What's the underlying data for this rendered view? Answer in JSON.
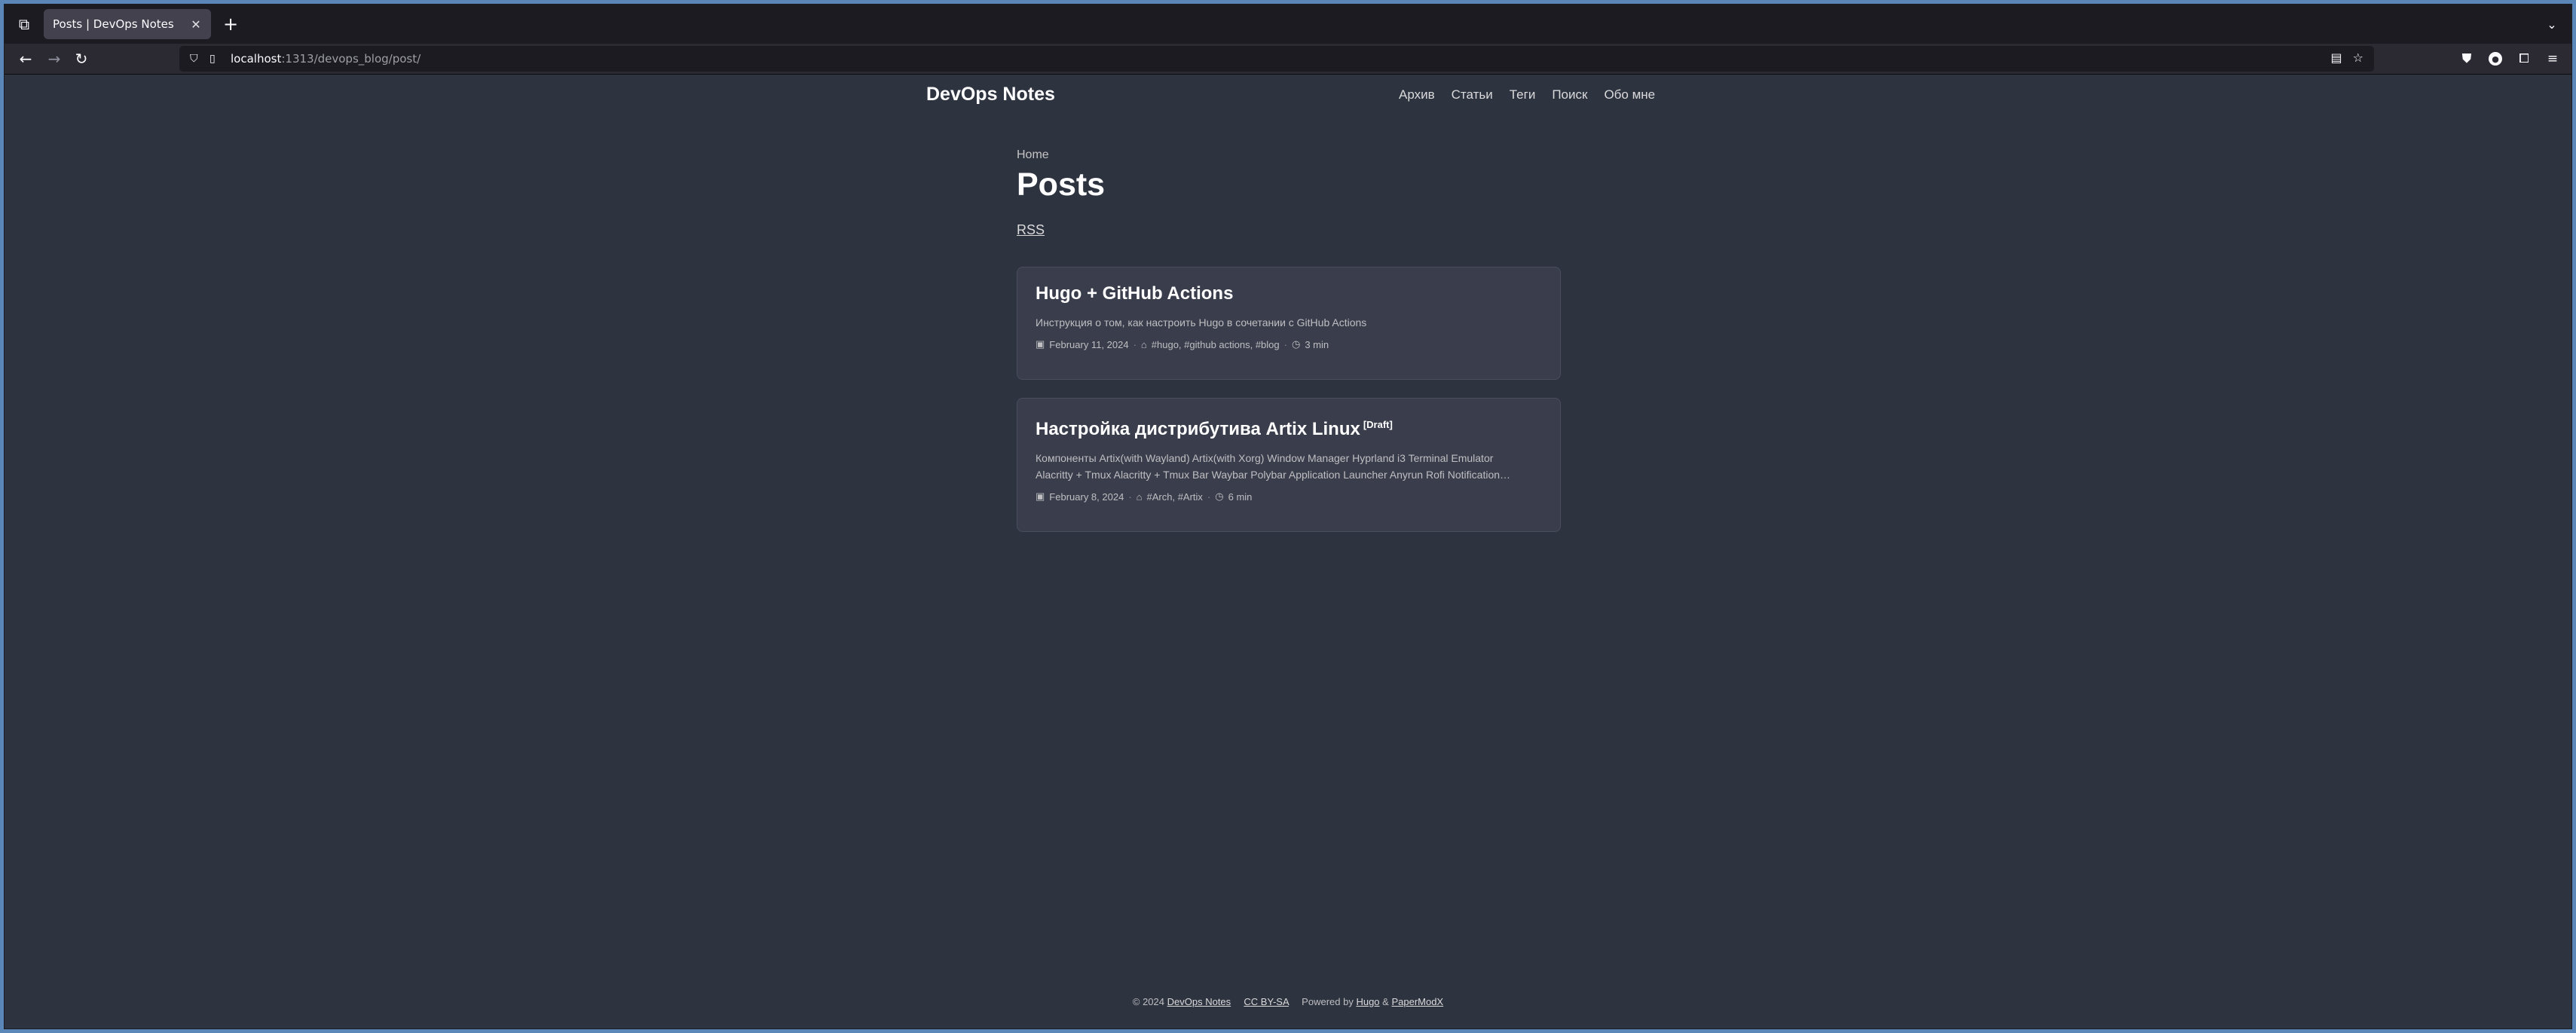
{
  "browser": {
    "tab_title": "Posts | DevOps Notes",
    "url_host": "localhost",
    "url_path": ":1313/devops_blog/post/"
  },
  "site": {
    "logo": "DevOps Notes",
    "menu": [
      "Архив",
      "Статьи",
      "Теги",
      "Поиск",
      "Обо мне"
    ]
  },
  "page": {
    "breadcrumb": "Home",
    "title": "Posts",
    "rss": "RSS"
  },
  "posts": [
    {
      "title": "Hugo + GitHub Actions",
      "draft": "",
      "summary": "Инструкция о том, как настроить Hugo в сочетании с GitHub Actions",
      "date": "February 11, 2024",
      "tags": "#hugo, #github actions, #blog",
      "reading_time": "3 min"
    },
    {
      "title": "Настройка дистрибутива Artix Linux",
      "draft": "[Draft]",
      "summary_line1": "Компоненты Artix(with Wayland) Artix(with Xorg) Window Manager Hyprland i3 Terminal Emulator",
      "summary_line2": "Alacritty + Tmux Alacritty + Tmux Bar Waybar Polybar Application Launcher Anyrun Rofi Notification…",
      "date": "February 8, 2024",
      "tags": "#Arch, #Artix",
      "reading_time": "6 min"
    }
  ],
  "footer": {
    "copyright": "© 2024",
    "site_link": "DevOps Notes",
    "license": "CC BY-SA",
    "powered": "Powered by",
    "hugo": "Hugo",
    "amp": "&",
    "theme": "PaperModX"
  }
}
